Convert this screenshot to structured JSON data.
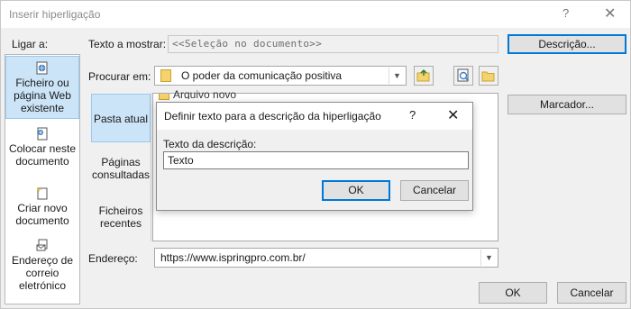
{
  "window": {
    "title": "Inserir hiperligação",
    "help_label": "?",
    "close_label": "✕"
  },
  "link_to": {
    "label": "Ligar a:",
    "items": [
      {
        "line1": "Ficheiro ou",
        "line2": "página Web",
        "line3": "existente",
        "icon": "web-page-icon",
        "selected": true
      },
      {
        "line1": "Colocar neste",
        "line2": "documento",
        "icon": "document-place-icon",
        "selected": false
      },
      {
        "line1": "Criar novo",
        "line2": "documento",
        "icon": "new-document-icon",
        "selected": false
      },
      {
        "line1": "Endereço de",
        "line2": "correio",
        "line3": "eletrónico",
        "icon": "email-icon",
        "selected": false
      }
    ]
  },
  "text_to_display": {
    "label": "Texto a mostrar:",
    "value": "<<Seleção no documento>>"
  },
  "screentip_button": "Descrição...",
  "bookmark_button": "Marcador...",
  "look_in": {
    "label": "Procurar em:",
    "value": "O poder da comunicação positiva"
  },
  "side_tabs": [
    {
      "line1": "Pasta atual",
      "selected": true
    },
    {
      "line1": "Páginas",
      "line2": "consultadas",
      "selected": false
    },
    {
      "line1": "Ficheiros",
      "line2": "recentes",
      "selected": false
    }
  ],
  "list_partial_item": "Arquivo novo",
  "address": {
    "label": "Endereço:",
    "value": "https://www.ispringpro.com.br/"
  },
  "ok_button": "OK",
  "cancel_button": "Cancelar",
  "screentip_dialog": {
    "title": "Definir texto para a descrição da hiperligação",
    "help_label": "?",
    "close_label": "✕",
    "field_label": "Texto da descrição:",
    "field_value": "Texto",
    "ok_button": "OK",
    "cancel_button": "Cancelar"
  },
  "colors": {
    "accent": "#0078d7",
    "selection": "#cce4f7",
    "dialog_bg": "#f0f0f0"
  }
}
